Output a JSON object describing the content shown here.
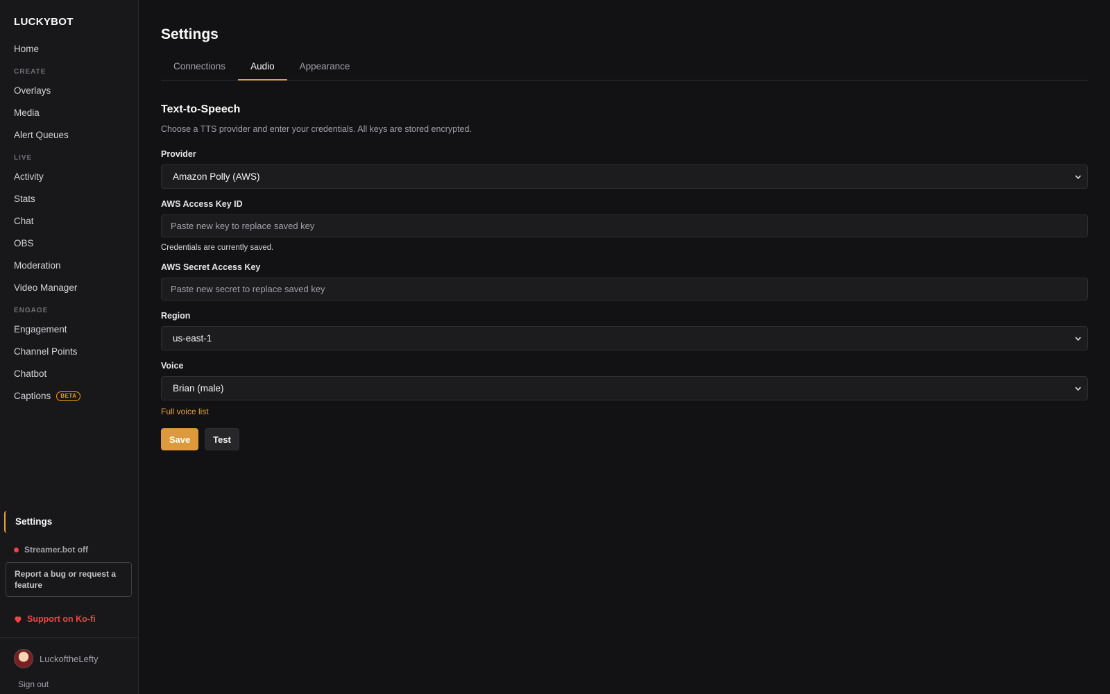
{
  "brand": "LUCKYBOT",
  "sidebar": {
    "home": "Home",
    "create_label": "CREATE",
    "overlays": "Overlays",
    "media": "Media",
    "alert_queues": "Alert Queues",
    "live_label": "LIVE",
    "activity": "Activity",
    "stats": "Stats",
    "chat": "Chat",
    "obs": "OBS",
    "moderation": "Moderation",
    "video_manager": "Video Manager",
    "engage_label": "ENGAGE",
    "engagement": "Engagement",
    "channel_points": "Channel Points",
    "chatbot": "Chatbot",
    "captions": "Captions",
    "captions_badge": "BETA",
    "settings": "Settings",
    "status_text": "Streamer.bot off",
    "status_color": "#ef4444",
    "bug_report": "Report a bug or request a feature",
    "kofi": "Support on Ko-fi",
    "username": "LuckoftheLefty",
    "sign_out": "Sign out"
  },
  "main": {
    "title": "Settings",
    "tabs": [
      "Connections",
      "Audio",
      "Appearance"
    ],
    "active_tab": "Audio",
    "section_title": "Text-to-Speech",
    "section_desc": "Choose a TTS provider and enter your credentials. All keys are stored encrypted.",
    "provider_label": "Provider",
    "provider_value": "Amazon Polly (AWS)",
    "access_key_label": "AWS Access Key ID",
    "access_key_placeholder": "Paste new key to replace saved key",
    "credentials_note": "Credentials are currently saved.",
    "secret_key_label": "AWS Secret Access Key",
    "secret_key_placeholder": "Paste new secret to replace saved key",
    "region_label": "Region",
    "region_value": "us-east-1",
    "voice_label": "Voice",
    "voice_value": "Brian (male)",
    "voice_list_link": "Full voice list",
    "save_label": "Save",
    "test_label": "Test"
  },
  "colors": {
    "accent": "#e5a13c",
    "background": "#121214",
    "sidebar": "#18181b",
    "danger": "#ef4444"
  }
}
